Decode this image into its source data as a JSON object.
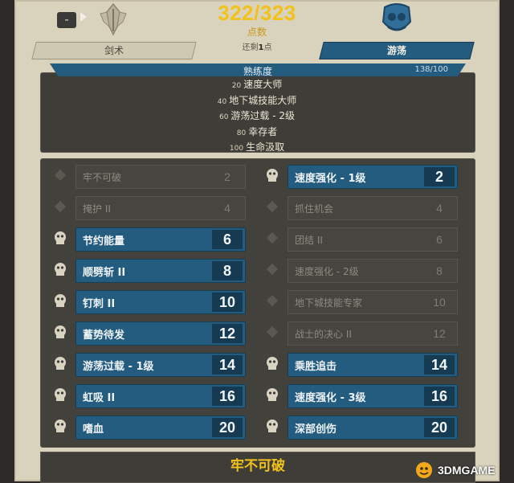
{
  "header": {
    "minus_label": "-",
    "points": "322/323",
    "points_label": "点数",
    "remaining_prefix": "还剩",
    "remaining_value": "1",
    "remaining_suffix": "点",
    "tab_left": "剑术",
    "tab_right": "游荡",
    "left_class_icon": "sword-emblem-icon",
    "right_class_icon": "rogue-emblem-icon"
  },
  "mastery": {
    "title": "熟练度",
    "count": "138/100",
    "items": [
      {
        "level": "20",
        "name": "速度大师"
      },
      {
        "level": "40",
        "name": "地下城技能大师"
      },
      {
        "level": "60",
        "name": "游荡过载 - 2级"
      },
      {
        "level": "80",
        "name": "幸存者"
      },
      {
        "level": "100",
        "name": "生命汲取"
      }
    ]
  },
  "skills": {
    "left": [
      {
        "name": "牢不可破",
        "level": "2",
        "active": false
      },
      {
        "name": "掩护 II",
        "level": "4",
        "active": false
      },
      {
        "name": "节约能量",
        "level": "6",
        "active": true
      },
      {
        "name": "顺劈斩 II",
        "level": "8",
        "active": true
      },
      {
        "name": "钉刺 II",
        "level": "10",
        "active": true
      },
      {
        "name": "蓄势待发",
        "level": "12",
        "active": true
      },
      {
        "name": "游荡过载 - 1级",
        "level": "14",
        "active": true
      },
      {
        "name": "虹吸 II",
        "level": "16",
        "active": true
      },
      {
        "name": "嗜血",
        "level": "20",
        "active": true
      }
    ],
    "right": [
      {
        "name": "速度强化 - 1级",
        "level": "2",
        "active": true
      },
      {
        "name": "抓住机会",
        "level": "4",
        "active": false
      },
      {
        "name": "团结 II",
        "level": "6",
        "active": false
      },
      {
        "name": "速度强化 - 2级",
        "level": "8",
        "active": false
      },
      {
        "name": "地下城技能专家",
        "level": "10",
        "active": false
      },
      {
        "name": "战士的决心 II",
        "level": "12",
        "active": false
      },
      {
        "name": "乘胜追击",
        "level": "14",
        "active": true
      },
      {
        "name": "速度强化 - 3级",
        "level": "16",
        "active": true
      },
      {
        "name": "深部创伤",
        "level": "20",
        "active": true
      }
    ]
  },
  "detail": {
    "title": "牢不可破"
  },
  "watermark": {
    "text": "3DMGAME"
  },
  "colors": {
    "accent_gold": "#f2c21a",
    "active_blue": "#245c80",
    "panel_bg": "#d9d2bd",
    "dark_bg": "#43413b"
  }
}
